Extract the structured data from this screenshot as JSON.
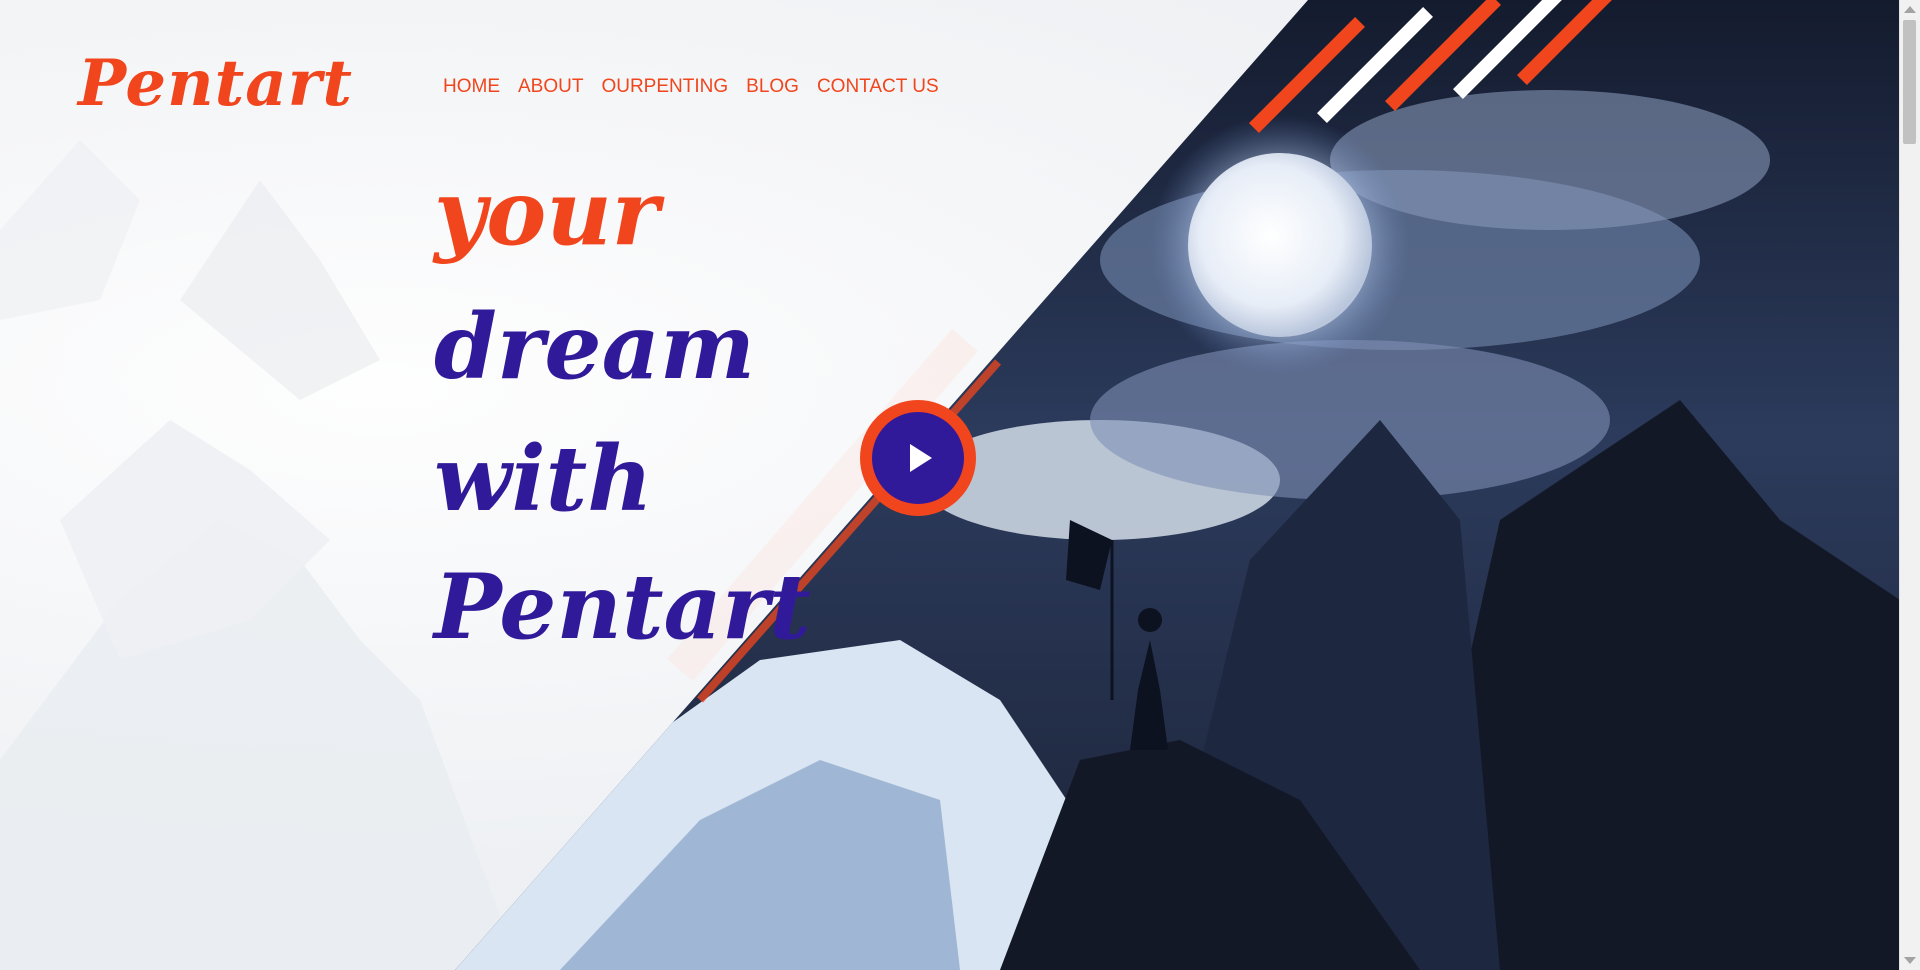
{
  "brand": {
    "logo_text": "Pentart"
  },
  "nav": {
    "items": [
      "HOME",
      "ABOUT",
      "OURPENTING",
      "BLOG",
      "CONTACT US"
    ]
  },
  "hero": {
    "line1": "your",
    "line2": "dream",
    "line3": "with",
    "line4": "Pentart"
  },
  "play_button": {
    "icon": "play-icon"
  },
  "colors": {
    "accent": "#f1461d",
    "primary": "#311a9a",
    "background": "#f3f4f6"
  },
  "icons": [
    "play-icon",
    "scroll-up-arrow-icon",
    "scroll-down-arrow-icon"
  ]
}
